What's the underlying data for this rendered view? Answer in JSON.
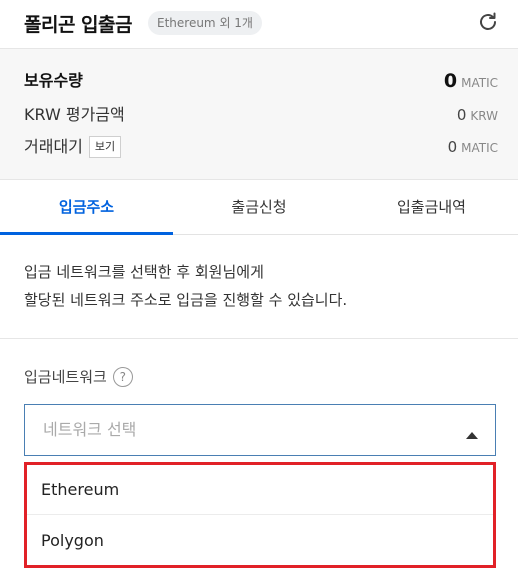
{
  "header": {
    "title": "폴리곤 입출금",
    "network_badge": "Ethereum 외 1개"
  },
  "balance": {
    "holdings_label": "보유수량",
    "holdings_value": "0",
    "holdings_unit": "MATIC",
    "krw_label": "KRW 평가금액",
    "krw_value": "0",
    "krw_unit": "KRW",
    "pending_label": "거래대기",
    "pending_view_button": "보기",
    "pending_value": "0",
    "pending_unit": "MATIC"
  },
  "tabs": [
    {
      "label": "입금주소",
      "active": true
    },
    {
      "label": "출금신청",
      "active": false
    },
    {
      "label": "입출금내역",
      "active": false
    }
  ],
  "deposit": {
    "description_line1": "입금 네트워크를 선택한 후 회원님에게",
    "description_line2": "할당된 네트워크 주소로 입금을 진행할 수 있습니다.",
    "network_label": "입금네트워크",
    "help_icon_glyph": "?",
    "select_placeholder": "네트워크 선택",
    "options": [
      "Ethereum",
      "Polygon"
    ]
  },
  "colors": {
    "accent": "#0062df",
    "highlight_border": "#e12127"
  }
}
